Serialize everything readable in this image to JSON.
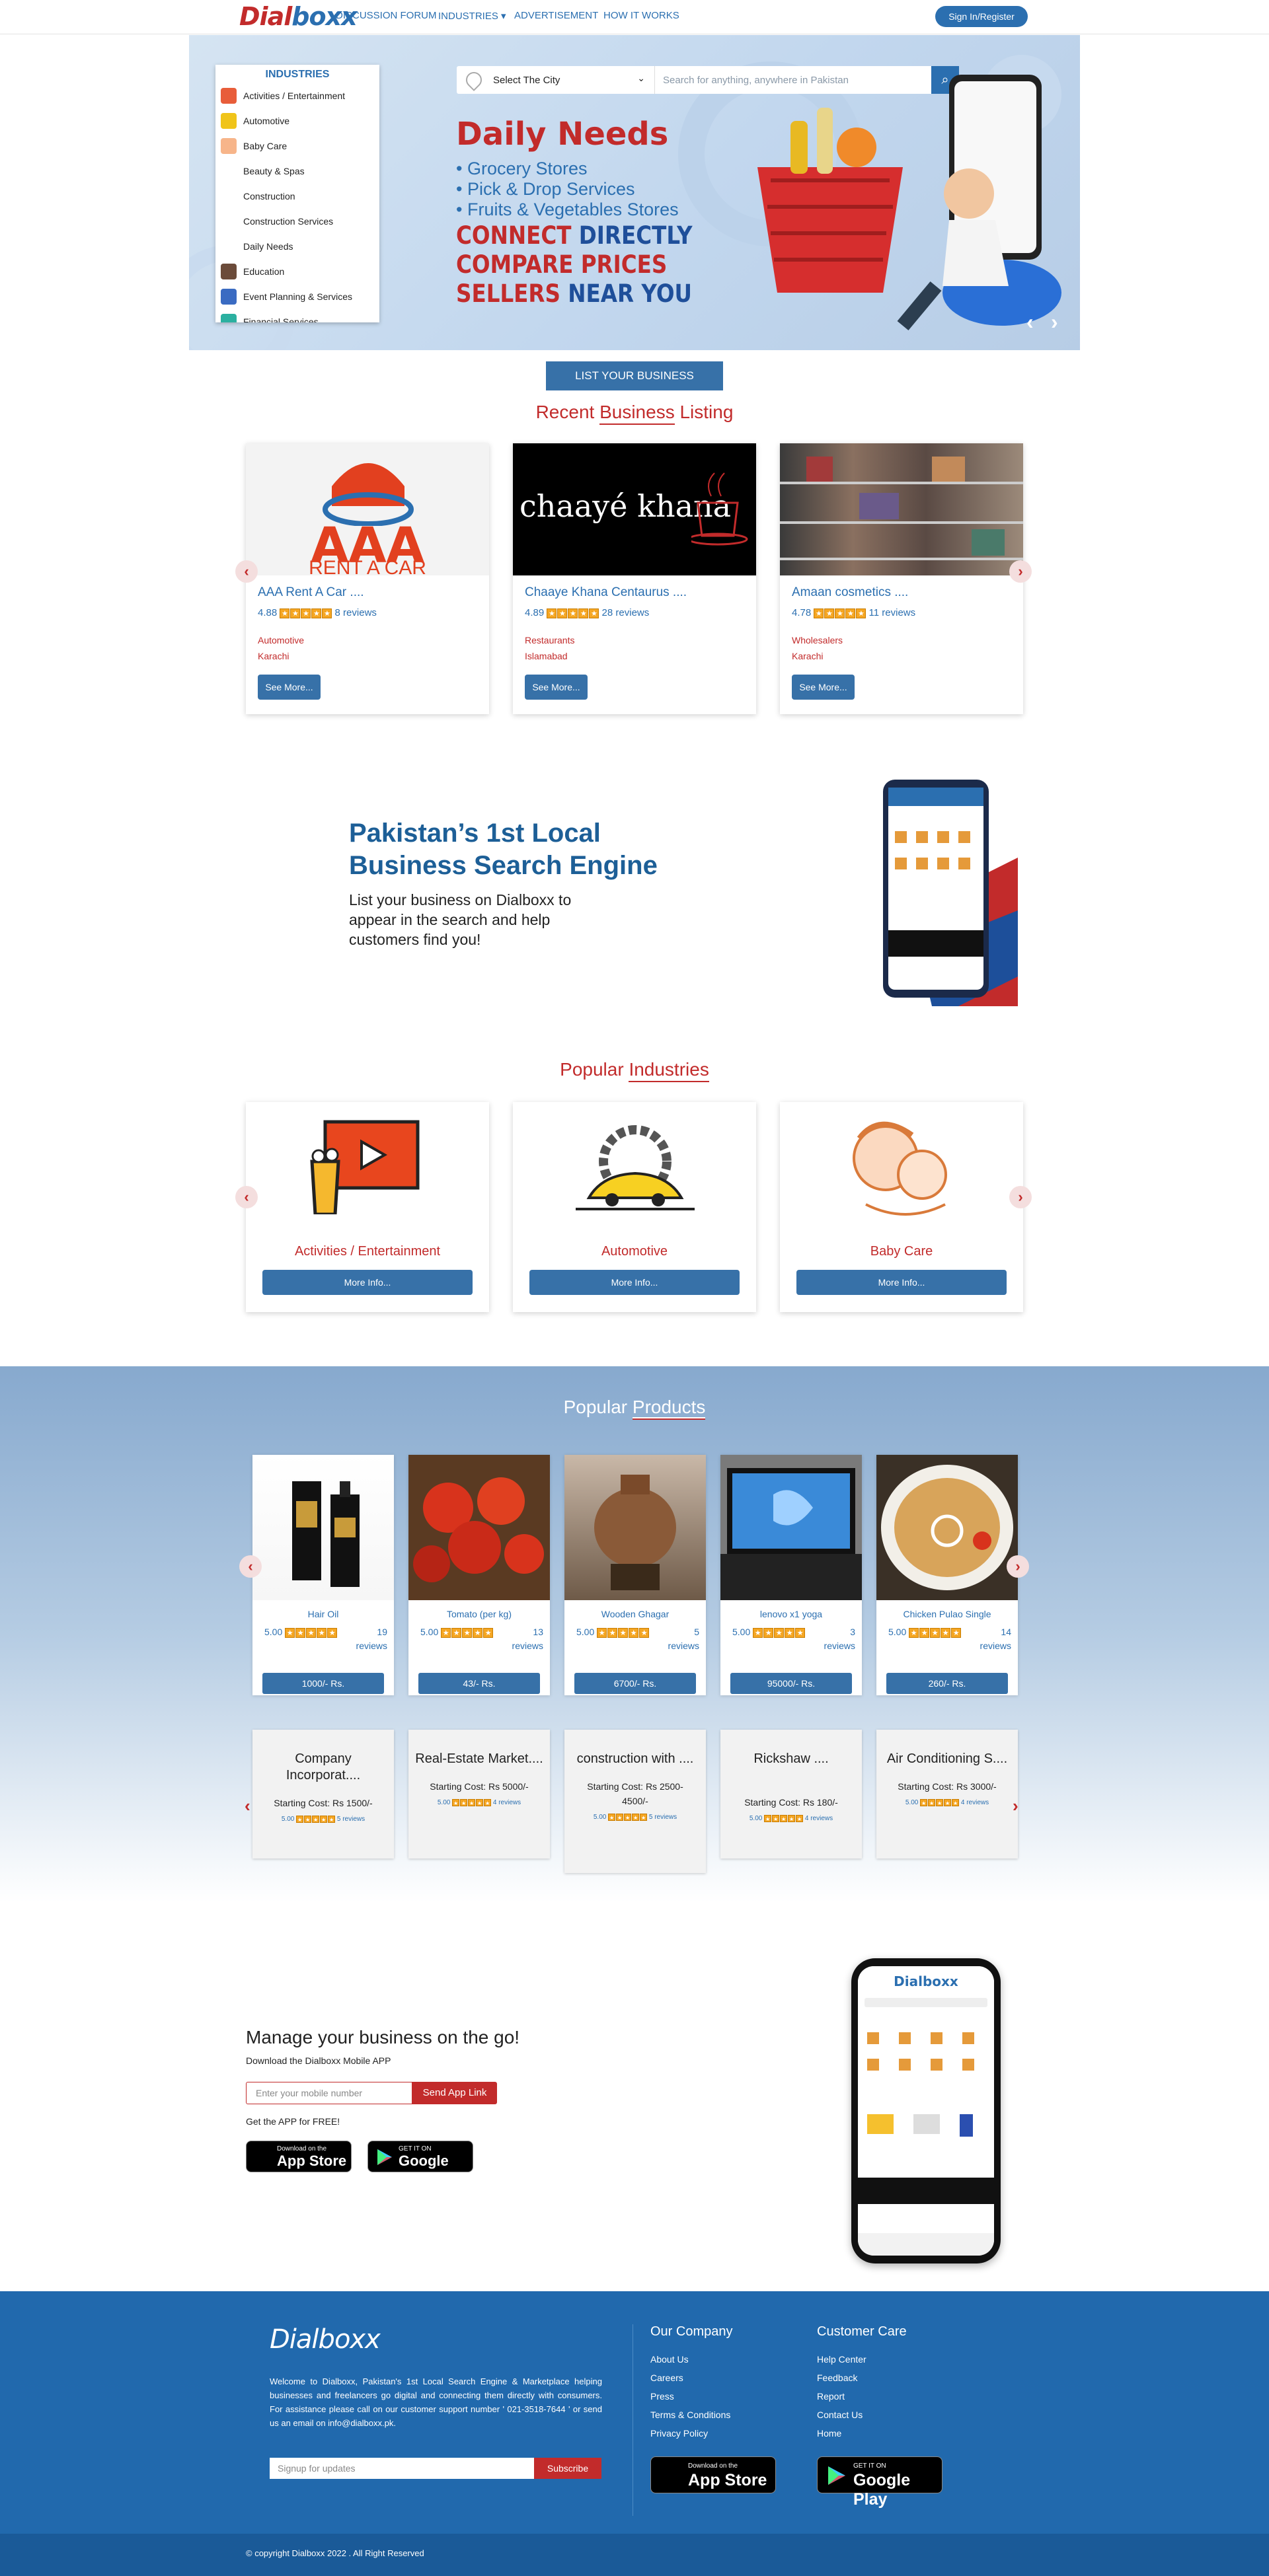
{
  "nav": {
    "logo_a": "Dial",
    "logo_b": "boxx",
    "links": [
      "DISCUSSION FORUM",
      "INDUSTRIES ▾",
      "ADVERTISEMENT",
      "HOW IT WORKS"
    ],
    "signin": "Sign In/Register"
  },
  "hero": {
    "industries_title": "INDUSTRIES",
    "industries": [
      "Activities / Entertainment",
      "Automotive",
      "Baby Care",
      "Beauty & Spas",
      "Construction",
      "Construction Services",
      "Daily Needs",
      "Education",
      "Event Planning & Services",
      "Financial Services"
    ],
    "city_select": "Select The City",
    "search_placeholder": "Search for anything, anywhere in Pakistan",
    "headline": "Daily Needs",
    "bullets": [
      "Grocery Stores",
      "Pick & Drop Services",
      "Fruits & Vegetables Stores"
    ],
    "slogan_connect": "CONNECT",
    "slogan_directly": "DIRECTLY",
    "slogan_compare": "COMPARE PRICES",
    "slogan_sellers": "SELLERS",
    "slogan_near": "NEAR YOU",
    "prev": "‹",
    "next": "›"
  },
  "list_business": "LIST YOUR BUSINESS",
  "recent": {
    "title_a": "Recent ",
    "title_b": "Business",
    "title_c": " Listing",
    "items": [
      {
        "name": "AAA Rent A Car ....",
        "rating": "4.88",
        "reviews": "8 reviews",
        "category": "Automotive",
        "city": "Karachi",
        "btn": "See More...",
        "img_text": "AAA",
        "img_sub": "RENT A CAR"
      },
      {
        "name": "Chaaye Khana Centaurus ....",
        "rating": "4.89",
        "reviews": "28 reviews",
        "category": "Restaurants",
        "city": "Islamabad",
        "btn": "See More...",
        "img_text": "chaayé khana"
      },
      {
        "name": "Amaan cosmetics ....",
        "rating": "4.78",
        "reviews": "11 reviews",
        "category": "Wholesalers",
        "city": "Karachi",
        "btn": "See More..."
      }
    ]
  },
  "promo": {
    "title_1": "Pakistan’s 1st Local",
    "title_2": "Business Search Engine",
    "text": "List your business on Dialboxx to appear in the search and help customers find you!"
  },
  "popular_industries": {
    "title_a": "Popular ",
    "title_b": "Industries",
    "items": [
      {
        "name": "Activities / Entertainment",
        "btn": "More Info..."
      },
      {
        "name": "Automotive",
        "btn": "More Info..."
      },
      {
        "name": "Baby Care",
        "btn": "More Info..."
      }
    ]
  },
  "popular_products": {
    "title_a": "Popular ",
    "title_b": "Products",
    "items": [
      {
        "name": "Hair Oil",
        "rating": "5.00",
        "reviews": "19",
        "reviews_word": "reviews",
        "price": "1000/- Rs."
      },
      {
        "name": "Tomato (per kg)",
        "rating": "5.00",
        "reviews": "13",
        "reviews_word": "reviews",
        "price": "43/- Rs."
      },
      {
        "name": "Wooden Ghagar",
        "rating": "5.00",
        "reviews": "5",
        "reviews_word": "reviews",
        "price": "6700/- Rs."
      },
      {
        "name": "lenovo x1 yoga",
        "rating": "5.00",
        "reviews": "3",
        "reviews_word": "reviews",
        "price": "95000/- Rs."
      },
      {
        "name": "Chicken Pulao Single",
        "rating": "5.00",
        "reviews": "14",
        "reviews_word": "reviews",
        "price": "260/- Rs."
      }
    ],
    "services": [
      {
        "name": "Company Incorporat....",
        "cost": "Starting Cost: Rs 1500/-",
        "rating": "5.00",
        "reviews": "5 reviews"
      },
      {
        "name": "Real-Estate Market....",
        "cost": "Starting Cost: Rs 5000/-",
        "rating": "5.00",
        "reviews": "4 reviews"
      },
      {
        "name": "construction with ....",
        "cost": "Starting Cost: Rs 2500-4500/-",
        "rating": "5.00",
        "reviews": "5 reviews"
      },
      {
        "name": "Rickshaw ....",
        "cost": "Starting Cost: Rs 180/-",
        "rating": "5.00",
        "reviews": "4 reviews"
      },
      {
        "name": "Air Conditioning S....",
        "cost": "Starting Cost: Rs 3000/-",
        "rating": "5.00",
        "reviews": "4 reviews"
      }
    ]
  },
  "app": {
    "title": "Manage your business on the go!",
    "subtitle": "Download the Dialboxx Mobile APP",
    "phone_placeholder": "Enter your mobile number",
    "send_btn": "Send App Link",
    "free": "Get the APP for FREE!",
    "appstore_small": "Download on the",
    "appstore_big": "App Store",
    "gplay_small": "GET IT ON",
    "gplay_big": "Google Play"
  },
  "footer": {
    "about": "Welcome to Dialboxx, Pakistan's 1st Local Search Engine & Marketplace helping businesses and freelancers go digital and connecting them directly with consumers. For assistance please call on our customer support number ' 021-3518-7644 ' or send us an email on info@dialboxx.pk.",
    "signup_placeholder": "Signup for updates",
    "subscribe": "Subscribe",
    "company_title": "Our Company",
    "company_links": [
      "About Us",
      "Careers",
      "Press",
      "Terms & Conditions",
      "Privacy Policy"
    ],
    "care_title": "Customer Care",
    "care_links": [
      "Help Center",
      "Feedback",
      "Report",
      "Contact Us",
      "Home"
    ],
    "copyright": "© copyright Dialboxx 2022 . All Right Reserved"
  },
  "colors": {
    "brand_red": "#c22b2b",
    "brand_blue": "#2b6fb0",
    "footer_blue": "#2169ad",
    "star": "#f5a623"
  }
}
